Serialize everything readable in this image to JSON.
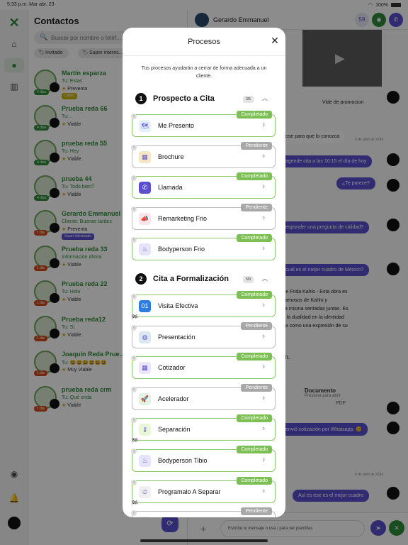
{
  "status_bar": {
    "time": "5:33 p.m.",
    "date": "Mar abr. 23",
    "battery": "100%"
  },
  "rail": {
    "icons": [
      "home-icon",
      "chat-icon",
      "stats-icon",
      "whatsapp-icon",
      "bell-icon"
    ]
  },
  "contacts": {
    "title": "Contactos",
    "search_placeholder": "Buscar por nombre o teléf...",
    "chips": [
      "Invitado",
      "Super interes..."
    ],
    "items": [
      {
        "name": "Martín esparza",
        "message": "Tu: Estas",
        "stage": "Preventa",
        "tag": "4 dias",
        "badge": "Cálido",
        "badge_color": "#c9b400"
      },
      {
        "name": "Prueba reda 66",
        "message": "Tu: .",
        "stage": "Viable",
        "tag": "4 dias",
        "badge": "",
        "badge_color": ""
      },
      {
        "name": "prueba reda 55",
        "message": "Tu: Hey",
        "stage": "Viable",
        "tag": "4 dias",
        "badge": "",
        "badge_color": ""
      },
      {
        "name": "prueba 44",
        "message": "Tu: Todo bien?",
        "stage": "Viable",
        "tag": "4 dias",
        "badge": "",
        "badge_color": ""
      },
      {
        "name": "Gerardo Emmanuel",
        "message": "Cliente: Buenas tardes",
        "stage": "Preventa",
        "tag": "1 dia",
        "badge": "Super interesado",
        "badge_color": "#5a4fcf"
      },
      {
        "name": "Prueba reda 33",
        "message": "Información ahora",
        "stage": "Viable",
        "tag": "1 dia",
        "badge": "",
        "badge_color": ""
      },
      {
        "name": "Prueba reda 22",
        "message": "Tu: Hola",
        "stage": "Viable",
        "tag": "1 dia",
        "badge": "",
        "badge_color": ""
      },
      {
        "name": "Prueba reda12",
        "message": "Tu: Si",
        "stage": "Viable",
        "tag": "1 dia",
        "badge": "",
        "badge_color": ""
      },
      {
        "name": "Joaquín Reda Prue...",
        "message": "Tu: 😀😀😀😀😀😀",
        "stage": "Muy Viable",
        "tag": "1 dia",
        "badge": "",
        "badge_color": ""
      },
      {
        "name": "prueba reda crm",
        "message": "Tu: Qué onda",
        "stage": "Viable",
        "tag": "1 dia",
        "badge": "",
        "badge_color": ""
      }
    ]
  },
  "chat": {
    "contact_name": "Gerardo Emmanuel",
    "video_caption": "Vide de promocion",
    "messages": [
      {
        "text": "ose para que lo conozca",
        "dir": "in"
      },
      {
        "text": "agende cita a las 10:15 el día de hoy",
        "dir": "out"
      },
      {
        "text": "¿Te parece?",
        "dir": "out"
      },
      {
        "text": "esponder una pregunta de calidad?",
        "dir": "out"
      },
      {
        "text": "cuál es el mejor cuadro de México?",
        "dir": "out"
      },
      {
        "text": "envió cotización por Whatsapp. 😊",
        "dir": "out"
      },
      {
        "text": "Así es ese es el mejor cuadro",
        "dir": "out"
      }
    ],
    "partial_lines": [
      "\" de Frida Kahlo - Esta obra es",
      "s famosos de Kahlo y",
      "ella misma sentadas juntas. Es",
      "de la dualidad en la identidad",
      "ada como una expresión de su"
    ],
    "fragment": "ión.",
    "date_1": "9 de abril de 2024",
    "date_2": "9 de abril de 2024",
    "document": {
      "title": "Documento",
      "subtitle": "Presiona para abrir",
      "type": "PDF"
    },
    "composer_placeholder": "Escribe tu mensaje o usa / para ver plantillas"
  },
  "modal": {
    "title": "Procesos",
    "description": "Tus procesos ayudarán a cerrar de forma adecuada a un cliente.",
    "sections": [
      {
        "number": "1",
        "title": "Prospecto a Cita",
        "count": "3/5",
        "items": [
          {
            "label": "Me Presento",
            "status": "Completado",
            "icon": "map-icon",
            "flag": false
          },
          {
            "label": "Brochure",
            "status": "Pendiente",
            "icon": "brochure-icon",
            "flag": false
          },
          {
            "label": "Llamada",
            "status": "Completado",
            "icon": "phone-icon",
            "flag": false
          },
          {
            "label": "Remarketing Frio",
            "status": "Pendiente",
            "icon": "megaphone-icon",
            "flag": false
          },
          {
            "label": "Bodyperson Frio",
            "status": "Completado",
            "icon": "flame-icon",
            "flag": false
          }
        ]
      },
      {
        "number": "2",
        "title": "Cita a Formalización",
        "count": "5/9",
        "items": [
          {
            "label": "Visita Efectiva",
            "status": "Completado",
            "icon": "calendar-icon",
            "flag": true
          },
          {
            "label": "Presentación",
            "status": "Pendiente",
            "icon": "presentation-icon",
            "flag": false
          },
          {
            "label": "Cotizador",
            "status": "Completado",
            "icon": "calculator-icon",
            "flag": false
          },
          {
            "label": "Acelerador",
            "status": "Pendiente",
            "icon": "rocket-icon",
            "flag": false
          },
          {
            "label": "Separación",
            "status": "Completado",
            "icon": "key-icon",
            "flag": true
          },
          {
            "label": "Bodyperson Tibio",
            "status": "Completado",
            "icon": "flame-icon",
            "flag": false
          },
          {
            "label": "Programalo A Separar",
            "status": "Completado",
            "icon": "schedule-icon",
            "flag": true
          },
          {
            "label": "",
            "status": "Pendiente",
            "icon": "item-icon",
            "flag": false
          }
        ]
      }
    ]
  }
}
